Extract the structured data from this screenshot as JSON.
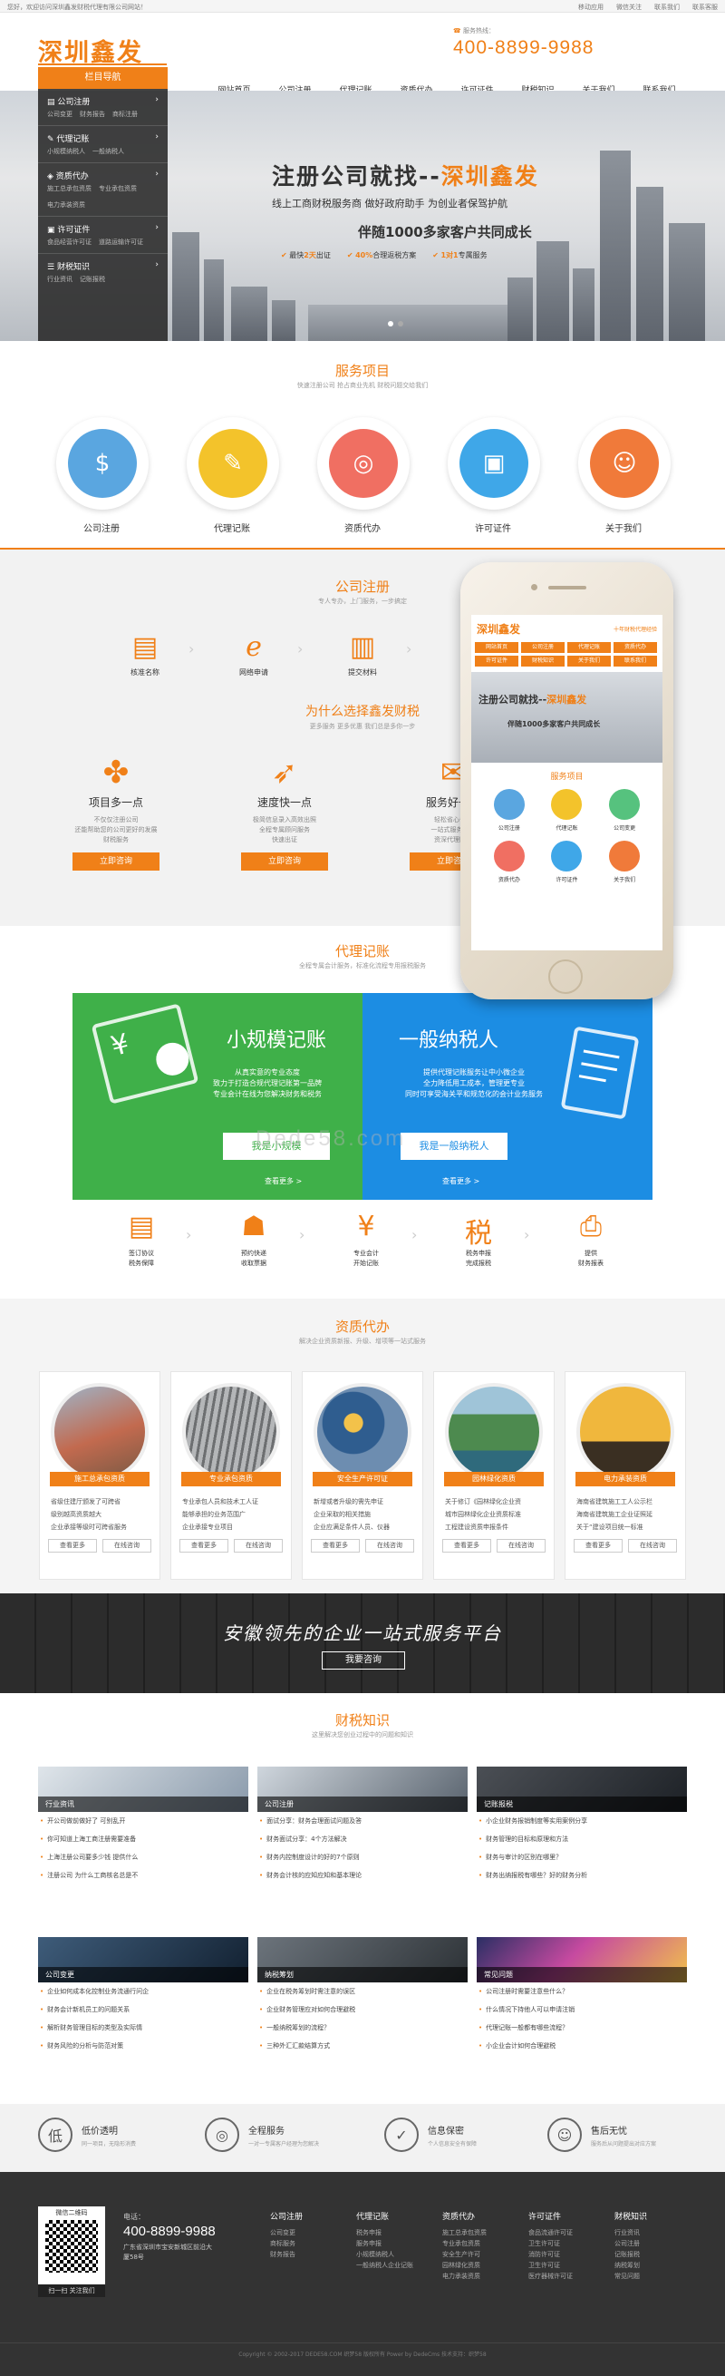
{
  "topbar": {
    "welcome": "您好，欢迎访问深圳鑫发财税代理有限公司网站！",
    "links": [
      "移动应用",
      "微信关注",
      "联系我们",
      "联系客服"
    ]
  },
  "header": {
    "logo": "深圳鑫发",
    "hotline_label": "服务热线：",
    "hotline": "400-8899-9988",
    "nav": [
      "网站首页",
      "公司注册",
      "代理记账",
      "资质代办",
      "许可证件",
      "财税知识",
      "关于我们",
      "联系我们"
    ]
  },
  "sidebar": {
    "title": "栏目导航",
    "items": [
      {
        "label": "公司注册",
        "subs": [
          "公司变更",
          "财务报告",
          "商标注册"
        ]
      },
      {
        "label": "代理记账",
        "subs": [
          "小规模纳税人",
          "一般纳税人"
        ]
      },
      {
        "label": "资质代办",
        "subs": [
          "施工总承包资质",
          "专业承包资质",
          "电力承装资质"
        ]
      },
      {
        "label": "许可证件",
        "subs": [
          "食品经营许可证",
          "道路运输许可证"
        ]
      },
      {
        "label": "财税知识",
        "subs": [
          "行业资讯",
          "记账报税"
        ]
      }
    ]
  },
  "banner": {
    "title_a": "注册公司就找--",
    "title_b": "深圳鑫发",
    "subtitle": "线上工商财税服务商  做好政府助手  为创业者保驾护航",
    "line3": "伴随1000多家客户共同成长",
    "points": [
      {
        "pre": "最快",
        "hl": "2天",
        "post": "出证"
      },
      {
        "pre": "",
        "hl": "40%",
        "post": "合理返税方案"
      },
      {
        "pre": "",
        "hl": "1对1",
        "post": "专属服务"
      }
    ]
  },
  "services": {
    "title": "服务项目",
    "subtitle": "快速注册公司 抢占商业先机 财税问题交给我们",
    "items": [
      {
        "label": "公司注册",
        "color": "#5aa6e0",
        "glyph": "$"
      },
      {
        "label": "代理记账",
        "color": "#f3c32b",
        "glyph": "✎"
      },
      {
        "label": "资质代办",
        "color": "#f06f62",
        "glyph": "◎"
      },
      {
        "label": "许可证件",
        "color": "#3fa7e8",
        "glyph": "▣"
      },
      {
        "label": "关于我们",
        "color": "#f07a3a",
        "glyph": "☺"
      }
    ]
  },
  "register": {
    "title": "公司注册",
    "subtitle": "专人专办，上门服务，一步搞定",
    "steps": [
      "核准名称",
      "网络申请",
      "提交材料"
    ]
  },
  "why": {
    "title": "为什么选择鑫发财税",
    "subtitle": "更多服务 更多优惠 我们总是多你一步",
    "items": [
      {
        "title": "项目多一点",
        "desc": "不仅仅注册公司\n还能帮助您的公司更好的发展\n财税服务",
        "btn": "立即咨询"
      },
      {
        "title": "速度快一点",
        "desc": "极简信息录入高效出照\n全程专属顾问服务\n快速出证",
        "btn": "立即咨询"
      },
      {
        "title": "服务好一点",
        "desc": "轻松省心省力\n一站式服务体系\n资深代理团队",
        "btn": "立即咨询"
      }
    ]
  },
  "phone": {
    "logo": "深圳鑫发",
    "slogan": "十年财税代理经验",
    "nav": [
      "网站首页",
      "公司注册",
      "代理记账",
      "资质代办",
      "许可证件",
      "财税知识",
      "关于我们",
      "联系我们"
    ],
    "banner_a": "注册公司就找--",
    "banner_b": "深圳鑫发",
    "banner_c": "伴随1000多家客户共同成长",
    "section": "服务项目",
    "icons": [
      {
        "label": "公司注册",
        "color": "#5aa6e0"
      },
      {
        "label": "代理记账",
        "color": "#f3c32b"
      },
      {
        "label": "公司变更",
        "color": "#56c27e"
      },
      {
        "label": "资质代办",
        "color": "#f06f62"
      },
      {
        "label": "许可证件",
        "color": "#3fa7e8"
      },
      {
        "label": "关于我们",
        "color": "#f07a3a"
      }
    ]
  },
  "accounting": {
    "title": "代理记账",
    "subtitle": "全程专属会计服务，标准化流程专用报税服务",
    "small": {
      "title": "小规模记账",
      "desc": "从真实意的专业态度\n致力于打造合规代理记账第一品牌\n专业会计在线为您解决财务和税务",
      "btn": "我是小规模",
      "more": "查看更多 >"
    },
    "general": {
      "title": "一般纳税人",
      "desc": "提供代理记账服务让中小微企业\n全力降低用工成本，管理更专业\n同时可享受海关平和规范化的会计业务服务",
      "btn": "我是一般纳税人",
      "more": "查看更多 >"
    },
    "advantages": [
      "签订协议\n税务保障",
      "预约快递\n收取票据",
      "专业会计\n开始记账",
      "税务申报\n完成报税",
      "提供\n财务报表"
    ],
    "watermark": "Dede58.com"
  },
  "qualification": {
    "title": "资质代办",
    "subtitle": "解决企业资质新报、升级、增项等一站式服务",
    "cards": [
      {
        "tag": "施工总承包资质",
        "lines": [
          "省级住建厅颁发了可跨省",
          "级别越高资质越大",
          "企业承接等级时可跨省服务"
        ],
        "more": "查看更多",
        "ask": "在线咨询"
      },
      {
        "tag": "专业承包资质",
        "lines": [
          "专业承包人员和技术工人证",
          "能够承担的业务范围广",
          "企业承接专业项目"
        ],
        "more": "查看更多",
        "ask": "在线咨询"
      },
      {
        "tag": "安全生产许可证",
        "lines": [
          "新增或者升级的需先申证",
          "企业采取的相关措施",
          "企业应满足条件人员、仪器"
        ],
        "more": "查看更多",
        "ask": "在线咨询"
      },
      {
        "tag": "园林绿化资质",
        "lines": [
          "关于修订《园林绿化企业资",
          "城市园林绿化企业资质标准",
          "工程建设资质申报条件"
        ],
        "more": "查看更多",
        "ask": "在线咨询"
      },
      {
        "tag": "电力承装资质",
        "lines": [
          "海南省建筑施工工人公示栏",
          "海南省建筑施工企业证照延",
          "关于“建设项目统一标准"
        ],
        "more": "查看更多",
        "ask": "在线咨询"
      }
    ]
  },
  "band": {
    "text": "安徽领先的企业一站式服务平台",
    "btn": "我要咨询"
  },
  "knowledge": {
    "title": "财税知识",
    "subtitle": "这里解决您创业过程中的问题和知识",
    "blocks": [
      {
        "cat": "行业资讯",
        "items": [
          "开公司做前做好了 可别乱开",
          "你可知道上海工商注册需要准备",
          "上海注册公司要多少钱 提供什么",
          "注册公司 为什么工商核名总是不"
        ]
      },
      {
        "cat": "公司注册",
        "items": [
          "面试分享：财务会理面试问题及答",
          "财务面试分享：4个方法解决",
          "财务内控制度设计的好的7个原则",
          "财务会计核的应知应知和基本理论"
        ]
      },
      {
        "cat": "记账报税",
        "items": [
          "小企业财务报销制度等实用案例分享",
          "财务管理的目标和原理和方法",
          "财务与审计的区别在哪里？",
          "财务出纳报税有哪些？好的财务分析"
        ]
      },
      {
        "cat": "公司变更",
        "items": [
          "企业如何成本化控制业务流通行问企",
          "财务会计新机员工的问题关系",
          "解析财务管理目标的类型及实际情",
          "财务风险的分析与防范对策"
        ]
      },
      {
        "cat": "纳税筹划",
        "items": [
          "企业在税务筹划时需注意的误区",
          "企业财务管理应对如何合理避税",
          "一般纳税筹划的流程？",
          "三种外汇汇款结算方式"
        ]
      },
      {
        "cat": "常见问题",
        "items": [
          "公司注册时需要注意些什么？",
          "什么情况下持他人可以申请注销",
          "代理记账一般都有哪些流程？",
          "小企业会计如何合理避税"
        ]
      }
    ]
  },
  "features": [
    {
      "icon": "低",
      "title": "低价透明",
      "desc": "同一项目，无隐形消费"
    },
    {
      "icon": "◎",
      "title": "全程服务",
      "desc": "一对一专属客户经理为您解决"
    },
    {
      "icon": "✓",
      "title": "信息保密",
      "desc": "个人信息安全有保障"
    },
    {
      "icon": "☺",
      "title": "售后无忧",
      "desc": "服务后从问题提出对应方案"
    }
  ],
  "footer": {
    "qr_title": "微信二维码",
    "qr_foot": "扫一扫 关注我们",
    "tel_label": "电话：",
    "tel": "400-8899-9988",
    "address": "广东省深圳市宝安新城区前沿大厦58号",
    "cols": [
      {
        "h": "公司注册",
        "items": [
          "公司变更",
          "商标服务",
          "财务报告"
        ]
      },
      {
        "h": "代理记账",
        "items": [
          "税务申报",
          "服务申报",
          "小规模纳税人",
          "一般纳税人企业记账"
        ]
      },
      {
        "h": "资质代办",
        "items": [
          "施工总承包资质",
          "专业承包资质",
          "安全生产许可",
          "园林绿化资质",
          "电力承装资质"
        ]
      },
      {
        "h": "许可证件",
        "items": [
          "食品流通许可证",
          "卫生许可证",
          "消防许可证",
          "卫生许可证",
          "医疗器械许可证"
        ]
      },
      {
        "h": "财税知识",
        "items": [
          "行业资讯",
          "公司注册",
          "记账报税",
          "纳税筹划",
          "常见问题"
        ]
      }
    ],
    "copyright": "Copyright © 2002-2017 DEDE58.COM 织梦58 版权所有 Power by DedeCms 技术支持：织梦58"
  }
}
